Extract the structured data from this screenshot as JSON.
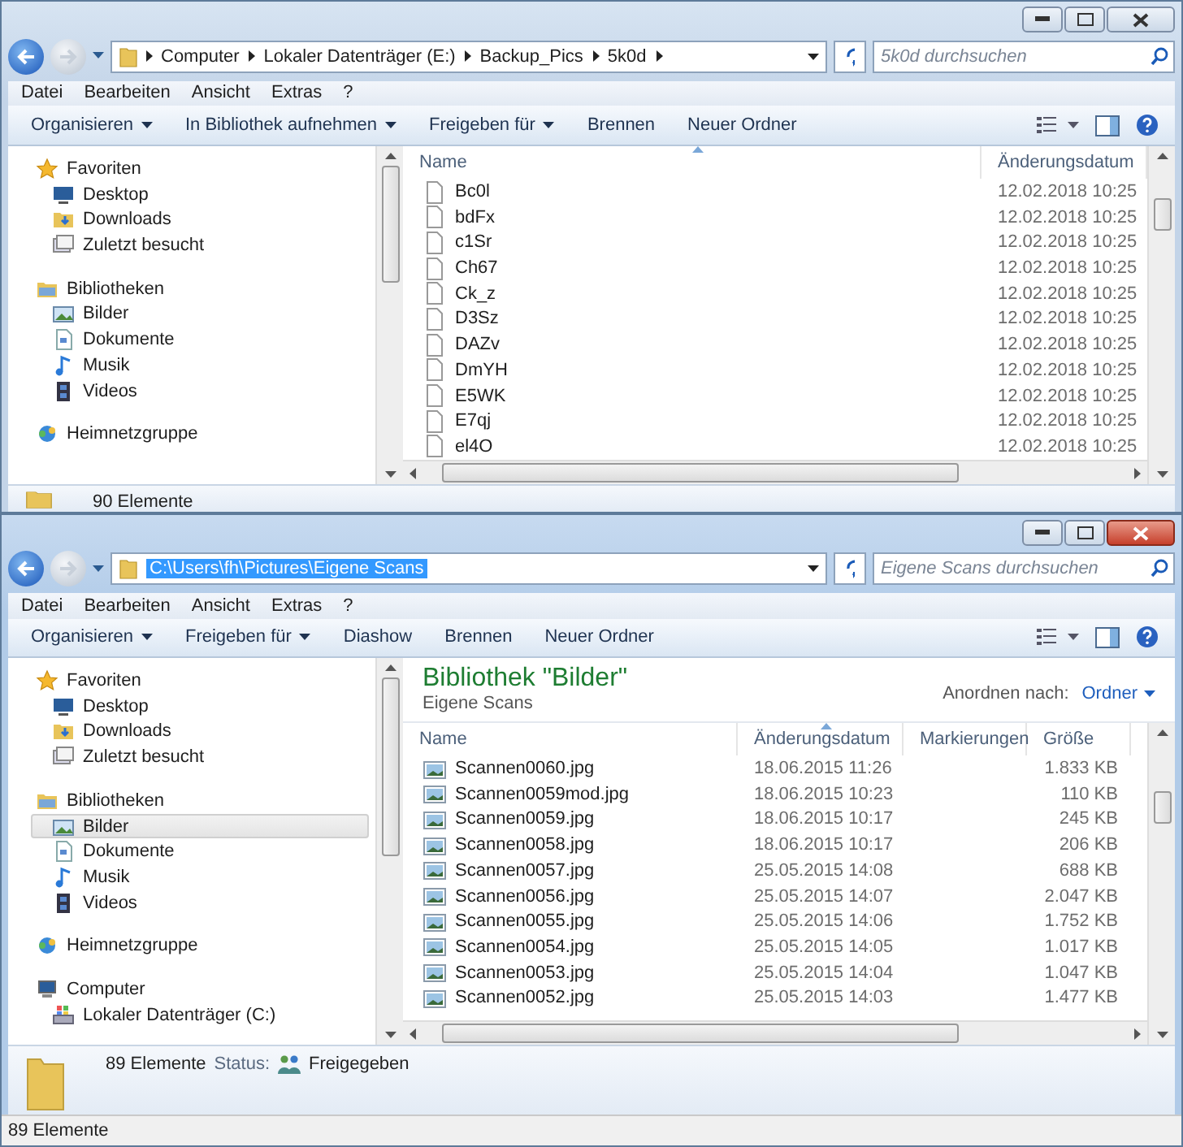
{
  "windows": [
    {
      "active": false,
      "address": {
        "kind": "breadcrumb",
        "crumbs": [
          "Computer",
          "Lokaler Datenträger (E:)",
          "Backup_Pics",
          "5k0d"
        ]
      },
      "search": {
        "placeholder": "5k0d durchsuchen"
      },
      "menu": [
        "Datei",
        "Bearbeiten",
        "Ansicht",
        "Extras",
        "?"
      ],
      "toolbar": [
        {
          "label": "Organisieren",
          "dropdown": true
        },
        {
          "label": "In Bibliothek aufnehmen",
          "dropdown": true
        },
        {
          "label": "Freigeben für",
          "dropdown": true
        },
        {
          "label": "Brennen",
          "dropdown": false
        },
        {
          "label": "Neuer Ordner",
          "dropdown": false
        }
      ],
      "nav_pane": [
        {
          "label": "Favoriten",
          "kind": "favorites",
          "selected": false,
          "children": [
            {
              "label": "Desktop",
              "kind": "desktop",
              "selected": false
            },
            {
              "label": "Downloads",
              "kind": "downloads",
              "selected": false
            },
            {
              "label": "Zuletzt besucht",
              "kind": "recent",
              "selected": false
            }
          ]
        },
        {
          "label": "Bibliotheken",
          "kind": "libraries",
          "selected": false,
          "children": [
            {
              "label": "Bilder",
              "kind": "pictures",
              "selected": false
            },
            {
              "label": "Dokumente",
              "kind": "documents",
              "selected": false
            },
            {
              "label": "Musik",
              "kind": "music",
              "selected": false
            },
            {
              "label": "Videos",
              "kind": "videos",
              "selected": false
            }
          ]
        },
        {
          "label": "Heimnetzgruppe",
          "kind": "homegroup",
          "selected": false
        }
      ],
      "columns": [
        {
          "label": "Name",
          "kind": "name",
          "sorted": true
        },
        {
          "label": "Änderungsdatum",
          "kind": "date",
          "sorted": false
        }
      ],
      "rows": [
        {
          "name": "Bc0l",
          "date": "12.02.2018 10:25",
          "kind": "file"
        },
        {
          "name": "bdFx",
          "date": "12.02.2018 10:25",
          "kind": "file"
        },
        {
          "name": "c1Sr",
          "date": "12.02.2018 10:25",
          "kind": "file"
        },
        {
          "name": "Ch67",
          "date": "12.02.2018 10:25",
          "kind": "file"
        },
        {
          "name": "Ck_z",
          "date": "12.02.2018 10:25",
          "kind": "file"
        },
        {
          "name": "D3Sz",
          "date": "12.02.2018 10:25",
          "kind": "file"
        },
        {
          "name": "DAZv",
          "date": "12.02.2018 10:25",
          "kind": "file"
        },
        {
          "name": "DmYH",
          "date": "12.02.2018 10:25",
          "kind": "file"
        },
        {
          "name": "E5WK",
          "date": "12.02.2018 10:25",
          "kind": "file"
        },
        {
          "name": "E7qj",
          "date": "12.02.2018 10:25",
          "kind": "file"
        },
        {
          "name": "el4O",
          "date": "12.02.2018 10:25",
          "kind": "file"
        }
      ],
      "details": {
        "items_text": "90 Elemente"
      }
    },
    {
      "active": true,
      "address": {
        "kind": "path",
        "text": "C:\\Users\\fh\\Pictures\\Eigene Scans",
        "selected": true
      },
      "search": {
        "placeholder": "Eigene Scans durchsuchen"
      },
      "menu": [
        "Datei",
        "Bearbeiten",
        "Ansicht",
        "Extras",
        "?"
      ],
      "toolbar": [
        {
          "label": "Organisieren",
          "dropdown": true
        },
        {
          "label": "Freigeben für",
          "dropdown": true
        },
        {
          "label": "Diashow",
          "dropdown": false
        },
        {
          "label": "Brennen",
          "dropdown": false
        },
        {
          "label": "Neuer Ordner",
          "dropdown": false
        }
      ],
      "nav_pane": [
        {
          "label": "Favoriten",
          "kind": "favorites",
          "selected": false,
          "children": [
            {
              "label": "Desktop",
              "kind": "desktop",
              "selected": false
            },
            {
              "label": "Downloads",
              "kind": "downloads",
              "selected": false
            },
            {
              "label": "Zuletzt besucht",
              "kind": "recent",
              "selected": false
            }
          ]
        },
        {
          "label": "Bibliotheken",
          "kind": "libraries",
          "selected": false,
          "children": [
            {
              "label": "Bilder",
              "kind": "pictures",
              "selected": true
            },
            {
              "label": "Dokumente",
              "kind": "documents",
              "selected": false
            },
            {
              "label": "Musik",
              "kind": "music",
              "selected": false
            },
            {
              "label": "Videos",
              "kind": "videos",
              "selected": false
            }
          ]
        },
        {
          "label": "Heimnetzgruppe",
          "kind": "homegroup",
          "selected": false
        },
        {
          "label": "Computer",
          "kind": "computer",
          "selected": false,
          "children": [
            {
              "label": "Lokaler Datenträger (C:)",
              "kind": "drive",
              "selected": false
            }
          ]
        }
      ],
      "library": {
        "title": "Bibliothek \"Bilder\"",
        "subtitle": "Eigene Scans",
        "arrange_label": "Anordnen nach:",
        "arrange_value": "Ordner"
      },
      "columns": [
        {
          "label": "Name",
          "kind": "name",
          "sorted": false
        },
        {
          "label": "Änderungsdatum",
          "kind": "date",
          "sorted": true
        },
        {
          "label": "Markierungen",
          "kind": "tags",
          "sorted": false
        },
        {
          "label": "Größe",
          "kind": "size",
          "sorted": false
        }
      ],
      "rows": [
        {
          "name": "Scannen0060.jpg",
          "date": "18.06.2015 11:26",
          "size": "1.833 KB",
          "kind": "image"
        },
        {
          "name": "Scannen0059mod.jpg",
          "date": "18.06.2015 10:23",
          "size": "110 KB",
          "kind": "image"
        },
        {
          "name": "Scannen0059.jpg",
          "date": "18.06.2015 10:17",
          "size": "245 KB",
          "kind": "image"
        },
        {
          "name": "Scannen0058.jpg",
          "date": "18.06.2015 10:17",
          "size": "206 KB",
          "kind": "image"
        },
        {
          "name": "Scannen0057.jpg",
          "date": "25.05.2015 14:08",
          "size": "688 KB",
          "kind": "image"
        },
        {
          "name": "Scannen0056.jpg",
          "date": "25.05.2015 14:07",
          "size": "2.047 KB",
          "kind": "image"
        },
        {
          "name": "Scannen0055.jpg",
          "date": "25.05.2015 14:06",
          "size": "1.752 KB",
          "kind": "image"
        },
        {
          "name": "Scannen0054.jpg",
          "date": "25.05.2015 14:05",
          "size": "1.017 KB",
          "kind": "image"
        },
        {
          "name": "Scannen0053.jpg",
          "date": "25.05.2015 14:04",
          "size": "1.047 KB",
          "kind": "image"
        },
        {
          "name": "Scannen0052.jpg",
          "date": "25.05.2015 14:03",
          "size": "1.477 KB",
          "kind": "image"
        }
      ],
      "details": {
        "items_text": "89 Elemente",
        "status_label": "Status:",
        "status_value": "Freigegeben"
      },
      "status_bar": "89 Elemente"
    }
  ]
}
